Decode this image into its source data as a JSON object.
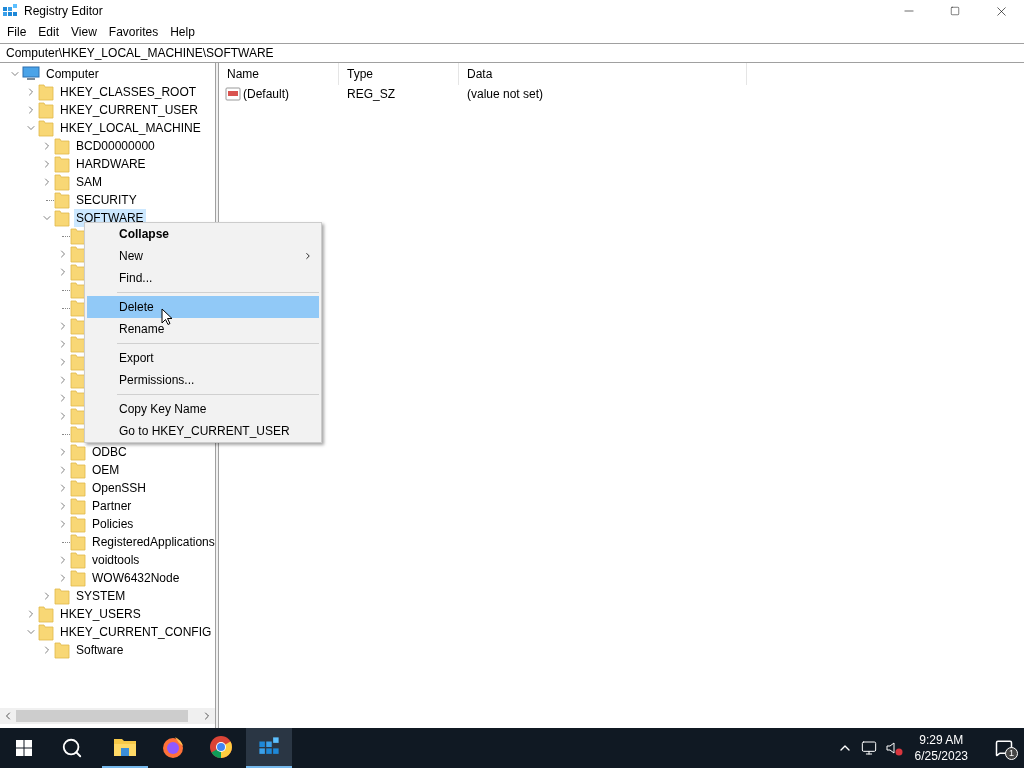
{
  "window": {
    "title": "Registry Editor"
  },
  "menu": [
    "File",
    "Edit",
    "View",
    "Favorites",
    "Help"
  ],
  "address": "Computer\\HKEY_LOCAL_MACHINE\\SOFTWARE",
  "tree": {
    "kind": "computer",
    "label": "Computer",
    "expandable": true,
    "expanded": true,
    "selected": false,
    "children": [
      {
        "kind": "folder",
        "label": "HKEY_CLASSES_ROOT",
        "expandable": true,
        "expanded": false,
        "selected": false
      },
      {
        "kind": "folder",
        "label": "HKEY_CURRENT_USER",
        "expandable": true,
        "expanded": false,
        "selected": false
      },
      {
        "kind": "folder",
        "label": "HKEY_LOCAL_MACHINE",
        "expandable": true,
        "expanded": true,
        "selected": false,
        "children": [
          {
            "kind": "folder",
            "label": "BCD00000000",
            "expandable": true,
            "expanded": false,
            "selected": false
          },
          {
            "kind": "folder",
            "label": "HARDWARE",
            "expandable": true,
            "expanded": false,
            "selected": false
          },
          {
            "kind": "folder",
            "label": "SAM",
            "expandable": true,
            "expanded": false,
            "selected": false
          },
          {
            "kind": "folder",
            "label": "SECURITY",
            "expandable": false,
            "selected": false
          },
          {
            "kind": "folder",
            "label": "SOFTWARE",
            "expandable": true,
            "expanded": true,
            "selected": true,
            "children": [
              {
                "kind": "folder",
                "expandable": false
              },
              {
                "kind": "folder",
                "expandable": true,
                "expanded": false
              },
              {
                "kind": "folder",
                "expandable": true,
                "expanded": false
              },
              {
                "kind": "folder",
                "expandable": false
              },
              {
                "kind": "folder",
                "expandable": false
              },
              {
                "kind": "folder",
                "expandable": true,
                "expanded": false
              },
              {
                "kind": "folder",
                "expandable": true,
                "expanded": false
              },
              {
                "kind": "folder",
                "expandable": true,
                "expanded": false
              },
              {
                "kind": "folder",
                "expandable": true,
                "expanded": false
              },
              {
                "kind": "folder",
                "expandable": true,
                "expanded": false
              },
              {
                "kind": "folder",
                "expandable": true,
                "expanded": false
              },
              {
                "kind": "folder",
                "expandable": false
              },
              {
                "kind": "folder",
                "label": "ODBC",
                "expandable": true,
                "expanded": false,
                "selected": false
              },
              {
                "kind": "folder",
                "label": "OEM",
                "expandable": true,
                "expanded": false,
                "selected": false
              },
              {
                "kind": "folder",
                "label": "OpenSSH",
                "expandable": true,
                "expanded": false,
                "selected": false
              },
              {
                "kind": "folder",
                "label": "Partner",
                "expandable": true,
                "expanded": false,
                "selected": false
              },
              {
                "kind": "folder",
                "label": "Policies",
                "expandable": true,
                "expanded": false,
                "selected": false
              },
              {
                "kind": "folder",
                "label": "RegisteredApplications",
                "expandable": false,
                "selected": false
              },
              {
                "kind": "folder",
                "label": "voidtools",
                "expandable": true,
                "expanded": false,
                "selected": false
              },
              {
                "kind": "folder",
                "label": "WOW6432Node",
                "expandable": true,
                "expanded": false,
                "selected": false
              }
            ]
          },
          {
            "kind": "folder",
            "label": "SYSTEM",
            "expandable": true,
            "expanded": false,
            "selected": false
          }
        ]
      },
      {
        "kind": "folder",
        "label": "HKEY_USERS",
        "expandable": true,
        "expanded": false,
        "selected": false
      },
      {
        "kind": "folder",
        "label": "HKEY_CURRENT_CONFIG",
        "expandable": true,
        "expanded": true,
        "selected": false,
        "children": [
          {
            "kind": "folder",
            "label": "Software",
            "expandable": true,
            "expanded": false,
            "selected": false
          }
        ]
      }
    ]
  },
  "table": {
    "columns": [
      "Name",
      "Type",
      "Data"
    ],
    "rows": [
      {
        "name": "(Default)",
        "type": "REG_SZ",
        "data": "(value not set)"
      }
    ]
  },
  "context_menu": {
    "items": [
      {
        "kind": "item",
        "label": "Collapse",
        "bold": true,
        "selected": false
      },
      {
        "kind": "submenu",
        "label": "New",
        "bold": false,
        "selected": false
      },
      {
        "kind": "item",
        "label": "Find...",
        "bold": false,
        "selected": false
      },
      {
        "kind": "separator"
      },
      {
        "kind": "item",
        "label": "Delete",
        "bold": false,
        "selected": true
      },
      {
        "kind": "item",
        "label": "Rename",
        "bold": false,
        "selected": false
      },
      {
        "kind": "separator"
      },
      {
        "kind": "item",
        "label": "Export",
        "bold": false,
        "selected": false
      },
      {
        "kind": "item",
        "label": "Permissions...",
        "bold": false,
        "selected": false
      },
      {
        "kind": "separator"
      },
      {
        "kind": "item",
        "label": "Copy Key Name",
        "bold": false,
        "selected": false
      },
      {
        "kind": "item",
        "label": "Go to HKEY_CURRENT_USER",
        "bold": false,
        "selected": false
      }
    ]
  },
  "taskbar": {
    "apps": [
      {
        "kind": "explorer",
        "running": true,
        "selected": false
      },
      {
        "kind": "firefox",
        "running": false,
        "selected": false
      },
      {
        "kind": "chrome",
        "running": false,
        "selected": false
      },
      {
        "kind": "regedit",
        "running": true,
        "selected": true
      }
    ],
    "time": "9:29 AM",
    "date": "6/25/2023",
    "notifications": "1"
  }
}
